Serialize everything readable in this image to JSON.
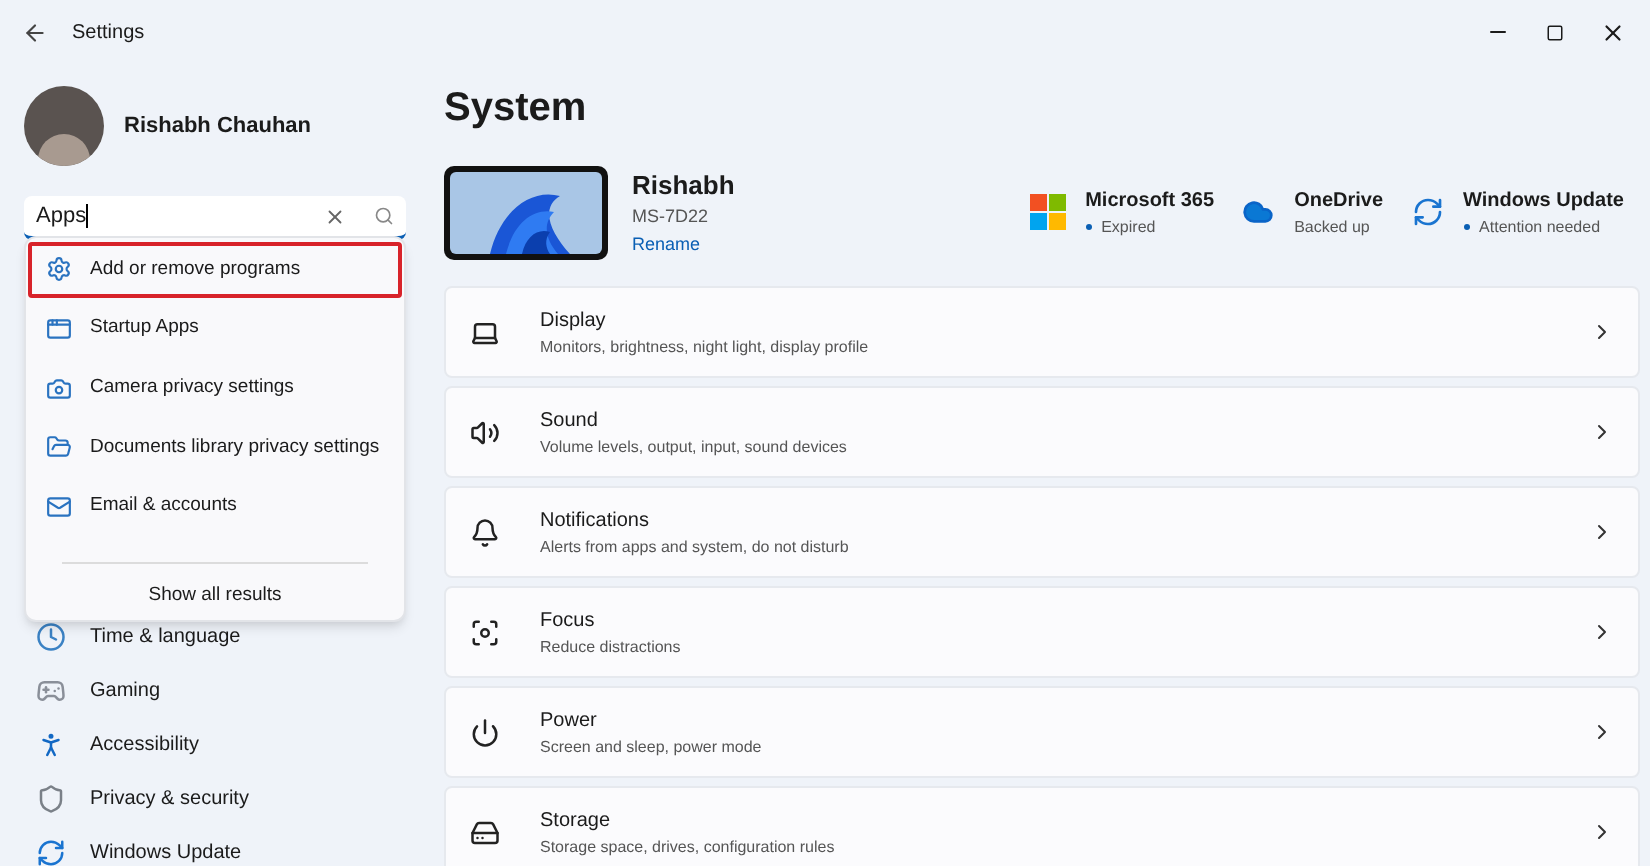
{
  "window": {
    "title": "Settings"
  },
  "user": {
    "name": "Rishabh Chauhan"
  },
  "search": {
    "value": "Apps"
  },
  "search_results": {
    "items": [
      {
        "label": "Add or remove programs",
        "selected": true
      },
      {
        "label": "Startup Apps",
        "selected": false
      },
      {
        "label": "Camera privacy settings",
        "selected": false
      },
      {
        "label": "Documents library privacy settings",
        "selected": false
      },
      {
        "label": "Email & accounts",
        "selected": false
      }
    ],
    "show_all": "Show all results"
  },
  "sidebar": {
    "items": [
      {
        "label": "Time & language"
      },
      {
        "label": "Gaming"
      },
      {
        "label": "Accessibility"
      },
      {
        "label": "Privacy & security"
      },
      {
        "label": "Windows Update"
      }
    ]
  },
  "page": {
    "title": "System"
  },
  "device": {
    "name": "Rishabh",
    "model": "MS-7D22",
    "rename": "Rename"
  },
  "status": [
    {
      "title": "Microsoft 365",
      "subtitle": "Expired",
      "dot": true
    },
    {
      "title": "OneDrive",
      "subtitle": "Backed up",
      "dot": false
    },
    {
      "title": "Windows Update",
      "subtitle": "Attention needed",
      "dot": true
    }
  ],
  "cards": [
    {
      "title": "Display",
      "subtitle": "Monitors, brightness, night light, display profile"
    },
    {
      "title": "Sound",
      "subtitle": "Volume levels, output, input, sound devices"
    },
    {
      "title": "Notifications",
      "subtitle": "Alerts from apps and system, do not disturb"
    },
    {
      "title": "Focus",
      "subtitle": "Reduce distractions"
    },
    {
      "title": "Power",
      "subtitle": "Screen and sleep, power mode"
    },
    {
      "title": "Storage",
      "subtitle": "Storage space, drives, configuration rules"
    }
  ]
}
